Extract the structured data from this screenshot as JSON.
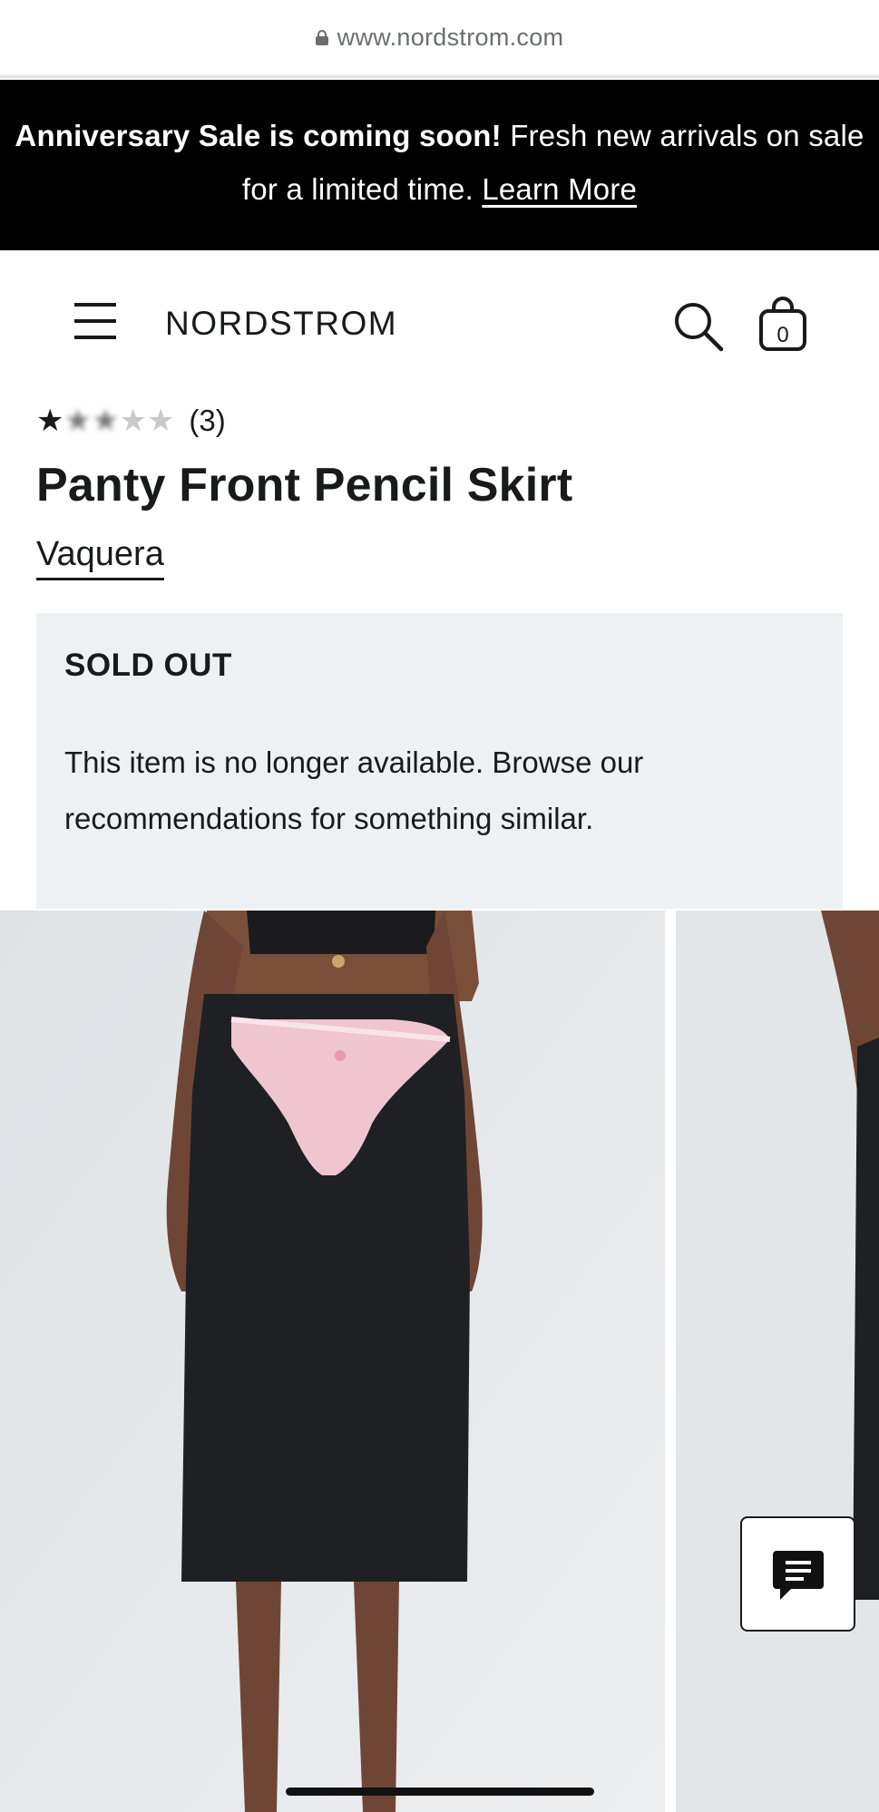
{
  "browser": {
    "url": "www.nordstrom.com"
  },
  "promo": {
    "bold_text": "Anniversary Sale is coming soon!",
    "text": " Fresh new arrivals on sale for a limited time. ",
    "link": "Learn More"
  },
  "header": {
    "logo": "NORDSTROM",
    "bag_count": "0"
  },
  "product": {
    "rating_stars": 1,
    "review_count": "(3)",
    "title": "Panty Front Pencil Skirt",
    "brand": "Vaquera"
  },
  "availability": {
    "heading": "SOLD OUT",
    "message": "This item is no longer available. Browse our recommendations for something similar."
  },
  "icons": {
    "menu": "hamburger-icon",
    "search": "search-icon",
    "bag": "shopping-bag-icon",
    "chat": "chat-icon",
    "lock": "lock-icon"
  },
  "colors": {
    "banner_bg": "#000000",
    "sold_out_bg": "#edf1f4",
    "text": "#191a1b"
  }
}
